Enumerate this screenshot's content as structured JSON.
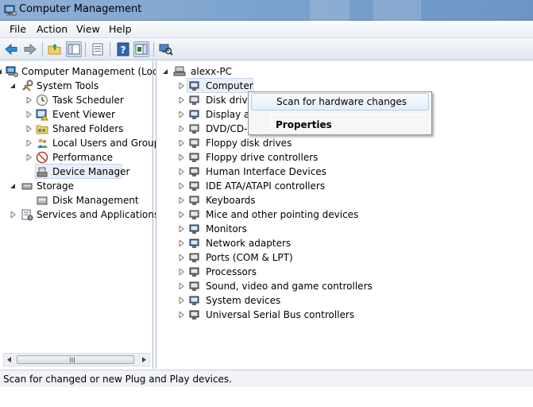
{
  "window": {
    "title": "Computer Management"
  },
  "menu": [
    "File",
    "Action",
    "View",
    "Help"
  ],
  "toolbar": [
    "back-icon",
    "forward-icon",
    "up-folder-icon",
    "show-hide-tree-icon",
    "properties-icon",
    "help-icon",
    "action-pane-icon",
    "scan-hardware-icon"
  ],
  "left_tree": {
    "root": "Computer Management (Local",
    "system_tools": "System Tools",
    "task_scheduler": "Task Scheduler",
    "event_viewer": "Event Viewer",
    "shared_folders": "Shared Folders",
    "local_users": "Local Users and Groups",
    "performance": "Performance",
    "device_manager": "Device Manager",
    "storage": "Storage",
    "disk_management": "Disk Management",
    "services": "Services and Applications"
  },
  "device_tree": {
    "root": "alexx-PC",
    "items": [
      "Computer",
      "Disk drives",
      "Display ad",
      "DVD/CD-R",
      "Floppy disk drives",
      "Floppy drive controllers",
      "Human Interface Devices",
      "IDE ATA/ATAPI controllers",
      "Keyboards",
      "Mice and other pointing devices",
      "Monitors",
      "Network adapters",
      "Ports (COM & LPT)",
      "Processors",
      "Sound, video and game controllers",
      "System devices",
      "Universal Serial Bus controllers"
    ]
  },
  "context_menu": {
    "scan": "Scan for hardware changes",
    "properties": "Properties"
  },
  "status": "Scan for changed or new Plug and Play devices.",
  "scrollbar": {
    "grip": "III"
  }
}
